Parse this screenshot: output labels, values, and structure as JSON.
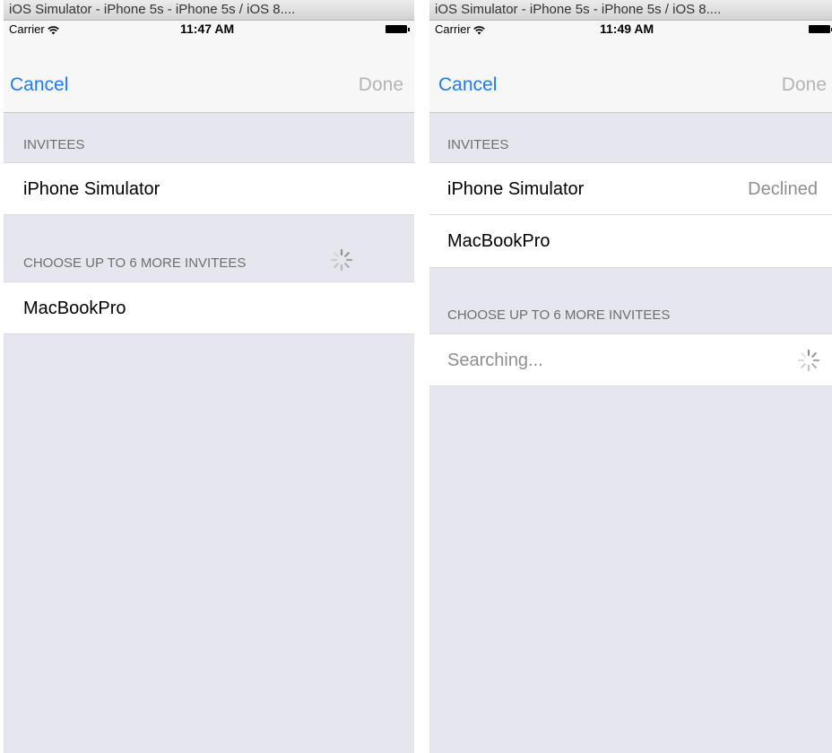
{
  "left": {
    "window_title": "iOS Simulator - iPhone 5s - iPhone 5s / iOS 8....",
    "carrier": "Carrier",
    "time": "11:47 AM",
    "cancel_label": "Cancel",
    "done_label": "Done",
    "invitees_header": "INVITEES",
    "invitees": [
      {
        "name": "iPhone Simulator"
      }
    ],
    "more_header": "CHOOSE UP TO 6 MORE INVITEES",
    "available": [
      {
        "name": "MacBookPro"
      }
    ]
  },
  "right": {
    "window_title": "iOS Simulator - iPhone 5s - iPhone 5s / iOS 8....",
    "carrier": "Carrier",
    "time": "11:49 AM",
    "cancel_label": "Cancel",
    "done_label": "Done",
    "invitees_header": "INVITEES",
    "invitees": [
      {
        "name": "iPhone Simulator",
        "status": "Declined"
      },
      {
        "name": "MacBookPro"
      }
    ],
    "more_header": "CHOOSE UP TO 6 MORE INVITEES",
    "searching_label": "Searching..."
  },
  "colors": {
    "tint": "#1a7ef0",
    "disabled_text": "#b4b4b8",
    "grouped_background": "#e6e6ee",
    "secondary_text": "#6d6d72",
    "detail_text": "#8e8e93"
  },
  "icons": {
    "wifi": "wifi-icon",
    "battery": "battery-icon",
    "spinner": "activity-spinner-icon"
  }
}
